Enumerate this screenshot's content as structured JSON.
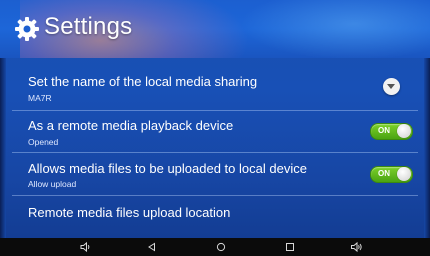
{
  "header": {
    "title": "Settings",
    "icon": "gear-icon"
  },
  "settings": [
    {
      "label": "Set the name of the local media sharing",
      "value": "MA7R",
      "control": "dropdown"
    },
    {
      "label": "As a remote media playback device",
      "value": "Opened",
      "control": "toggle",
      "toggle_text": "ON"
    },
    {
      "label": "Allows media files to be uploaded to local device",
      "value": "Allow upload",
      "control": "toggle",
      "toggle_text": "ON"
    },
    {
      "label": "Remote media files upload location"
    }
  ],
  "navbar": {
    "buttons": [
      "volume-down-icon",
      "back-icon",
      "home-icon",
      "recents-icon",
      "volume-up-icon"
    ]
  },
  "colors": {
    "accent_toggle": "#5ab51a",
    "background": "#1850b6"
  }
}
